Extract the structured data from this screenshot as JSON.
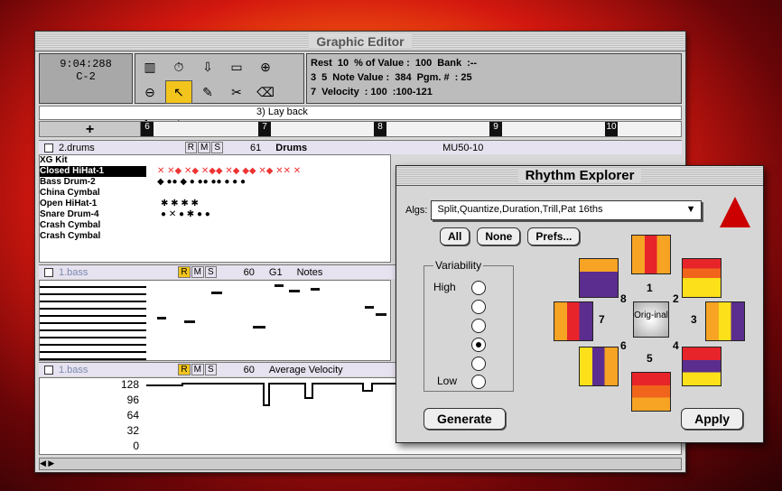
{
  "main_window": {
    "title": "Graphic Editor",
    "counter": {
      "time": "9:04:288",
      "note": "C-2"
    },
    "params": {
      "rest": "Rest",
      "row1": "10",
      "pct_label": "% of Value :",
      "pct_value": "100",
      "bank_label": "Bank",
      "bank_value": ":--",
      "n3": "3",
      "n5": "5",
      "nv_label": "Note Value :",
      "nv_value": "384",
      "pgm_label": "Pgm. #",
      "pgm_value": ": 25",
      "n7": "7",
      "vel_label": "Velocity",
      "vel_value": ": 100",
      "vel_range": ":100-121"
    },
    "marker": "3) Lay back",
    "ruler_plus": "+",
    "ruler_ticks": [
      "6",
      "7",
      "8",
      "9",
      "10"
    ],
    "track1": {
      "name": "2.drums",
      "r": "R",
      "m": "M",
      "s": "S",
      "num": "61",
      "type": "Drums",
      "device": "MU50-10"
    },
    "kit_name": "XG Kit",
    "drum_names": [
      "Closed HiHat-1",
      "Bass Drum-2",
      "China Cymbal",
      "Open HiHat-1",
      "Snare Drum-4",
      "Crash Cymbal",
      "Crash Cymbal"
    ],
    "track2": {
      "name": "1.bass",
      "r": "R",
      "m": "M",
      "s": "S",
      "num": "60",
      "note": "G1",
      "type": "Notes"
    },
    "track3": {
      "name": "1.bass",
      "r": "R",
      "m": "M",
      "s": "S",
      "num": "60",
      "type": "Average Velocity"
    },
    "velocity_axis": [
      "128",
      "96",
      "64",
      "32",
      "0"
    ]
  },
  "rhythm_explorer": {
    "title": "Rhythm Explorer",
    "algs_label": "Algs:",
    "algs_value": "Split,Quantize,Duration,Trill,Pat 16ths",
    "buttons": {
      "all": "All",
      "none": "None",
      "prefs": "Prefs..."
    },
    "variability_label": "Variability",
    "high_label": "High",
    "low_label": "Low",
    "selected_level": 4,
    "center_label": "Orig-inal",
    "tile_numbers": [
      "1",
      "2",
      "3",
      "4",
      "5",
      "6",
      "7",
      "8"
    ],
    "generate": "Generate",
    "apply": "Apply"
  }
}
